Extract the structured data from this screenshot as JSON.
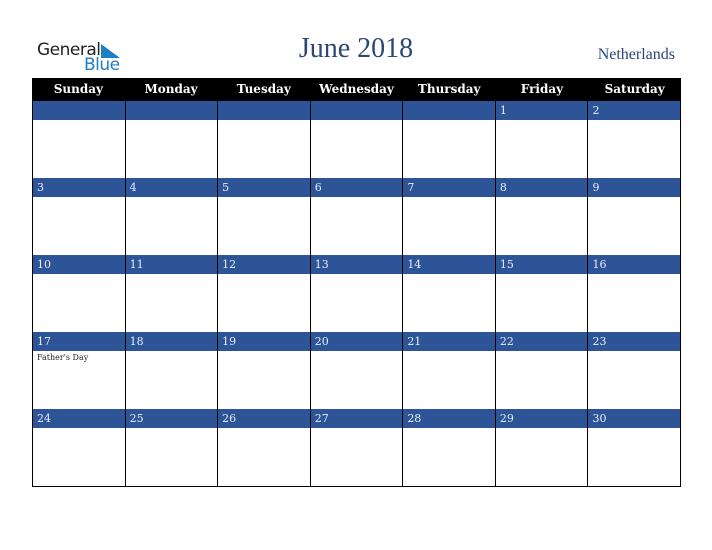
{
  "logo": {
    "line1": "General",
    "line2": "Blue"
  },
  "title": "June 2018",
  "country": "Netherlands",
  "weekdays": [
    "Sunday",
    "Monday",
    "Tuesday",
    "Wednesday",
    "Thursday",
    "Friday",
    "Saturday"
  ],
  "weeks": [
    [
      {
        "day": ""
      },
      {
        "day": ""
      },
      {
        "day": ""
      },
      {
        "day": ""
      },
      {
        "day": ""
      },
      {
        "day": "1"
      },
      {
        "day": "2"
      }
    ],
    [
      {
        "day": "3"
      },
      {
        "day": "4"
      },
      {
        "day": "5"
      },
      {
        "day": "6"
      },
      {
        "day": "7"
      },
      {
        "day": "8"
      },
      {
        "day": "9"
      }
    ],
    [
      {
        "day": "10"
      },
      {
        "day": "11"
      },
      {
        "day": "12"
      },
      {
        "day": "13"
      },
      {
        "day": "14"
      },
      {
        "day": "15"
      },
      {
        "day": "16"
      }
    ],
    [
      {
        "day": "17",
        "event": "Father's Day"
      },
      {
        "day": "18"
      },
      {
        "day": "19"
      },
      {
        "day": "20"
      },
      {
        "day": "21"
      },
      {
        "day": "22"
      },
      {
        "day": "23"
      }
    ],
    [
      {
        "day": "24"
      },
      {
        "day": "25"
      },
      {
        "day": "26"
      },
      {
        "day": "27"
      },
      {
        "day": "28"
      },
      {
        "day": "29"
      },
      {
        "day": "30"
      }
    ]
  ],
  "colors": {
    "band": "#2d5496",
    "header": "#000000",
    "title": "#2b4677",
    "logo_blue": "#1f7dc4"
  }
}
